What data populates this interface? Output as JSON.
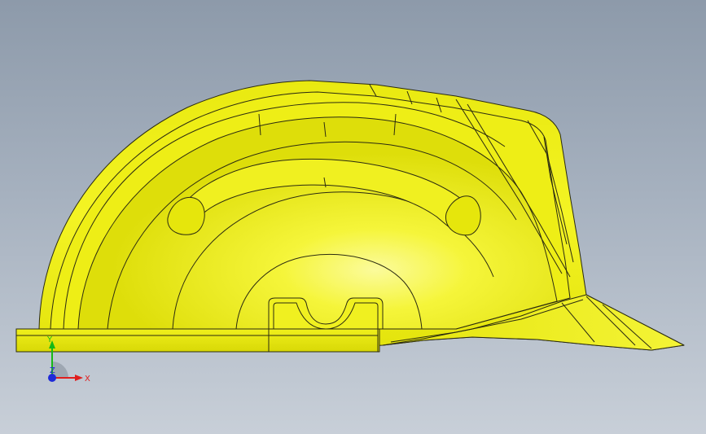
{
  "viewport": {
    "background_top": "#8d9aaa",
    "background_bottom": "#c8cfd8"
  },
  "model": {
    "name_icon": "hard-hat-model",
    "fill_color": "#f2f21e",
    "highlight_color": "#fbfb8a",
    "shadow_color": "#c9c905",
    "edge_color": "#2b2b10"
  },
  "triad": {
    "x_label": "X",
    "y_label": "Y",
    "z_label": "Z",
    "x_color": "#e01e1e",
    "y_color": "#16b916",
    "z_color": "#1e2ad8"
  }
}
